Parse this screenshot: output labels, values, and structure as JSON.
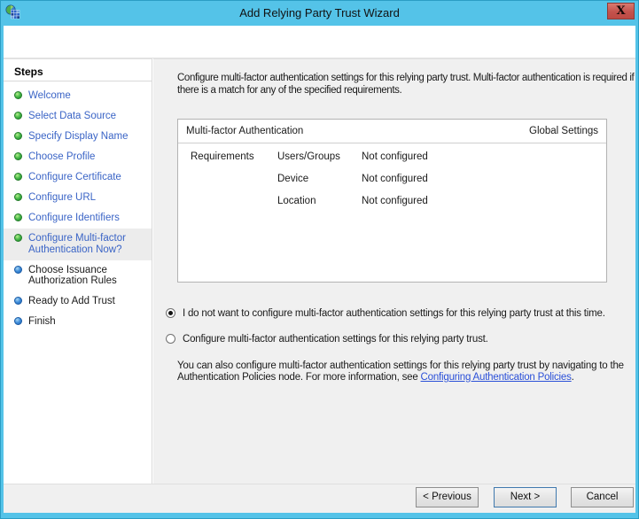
{
  "window": {
    "title": "Add Relying Party Trust Wizard",
    "close_glyph": "X"
  },
  "colors": {
    "titlebar": "#54c3e8",
    "close_button": "#c4524c",
    "step_link_blue": "#3a64c6",
    "bullet_done_green": "#2fa237",
    "bullet_future_blue": "#1d64b4",
    "link_blue": "#2b50d8",
    "content_bg": "#f0f0f0",
    "default_button_border": "#4079ae"
  },
  "steps": {
    "title": "Steps",
    "items": [
      {
        "label": "Welcome",
        "state": "done"
      },
      {
        "label": "Select Data Source",
        "state": "done"
      },
      {
        "label": "Specify Display Name",
        "state": "done"
      },
      {
        "label": "Choose Profile",
        "state": "done"
      },
      {
        "label": "Configure Certificate",
        "state": "done"
      },
      {
        "label": "Configure URL",
        "state": "done"
      },
      {
        "label": "Configure Identifiers",
        "state": "done"
      },
      {
        "label": "Configure Multi-factor Authentication Now?",
        "state": "current"
      },
      {
        "label": "Choose Issuance Authorization Rules",
        "state": "future"
      },
      {
        "label": "Ready to Add Trust",
        "state": "future"
      },
      {
        "label": "Finish",
        "state": "future"
      }
    ]
  },
  "main": {
    "intro": "Configure multi-factor authentication settings for this relying party trust. Multi-factor authentication is required if there is a match for any of the specified requirements.",
    "panel": {
      "header_left": "Multi-factor Authentication",
      "header_right": "Global Settings",
      "rows_label": "Requirements",
      "rows": [
        {
          "name": "Users/Groups",
          "value": "Not configured"
        },
        {
          "name": "Device",
          "value": "Not configured"
        },
        {
          "name": "Location",
          "value": "Not configured"
        }
      ]
    },
    "radios": [
      {
        "label": "I do not want to configure multi-factor authentication settings for this relying party trust at this time.",
        "selected": true
      },
      {
        "label": "Configure multi-factor authentication settings for this relying party trust.",
        "selected": false
      }
    ],
    "footnote_prefix": "You can also configure multi-factor authentication settings for this relying party trust by navigating to the Authentication Policies node. For more information, see ",
    "footnote_link": "Configuring Authentication Policies",
    "footnote_suffix": "."
  },
  "footer": {
    "previous": "< Previous",
    "next": "Next >",
    "cancel": "Cancel"
  }
}
